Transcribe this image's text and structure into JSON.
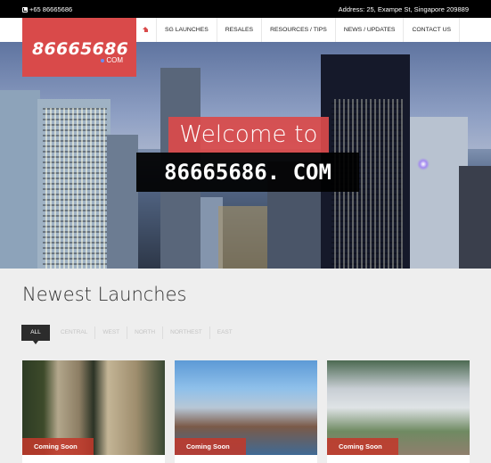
{
  "topbar": {
    "phone_icon": "phone-icon",
    "phone": "+65 86665686",
    "address": "Address: 25, Exampe St, Singapore 209889"
  },
  "logo": {
    "number": "86665686",
    "suffix": "COM",
    "dot_color": "#6a8cf0",
    "bg_color": "#d94a4a"
  },
  "nav": {
    "home_icon": "home-icon",
    "items": [
      {
        "label": "SG LAUNCHES"
      },
      {
        "label": "RESALES"
      },
      {
        "label": "RESOURCES / TIPS"
      },
      {
        "label": "NEWS / UPDATES"
      },
      {
        "label": "CONTACT US"
      }
    ]
  },
  "hero": {
    "line1": "Welcome to",
    "line2": "86665686. COM"
  },
  "launches": {
    "title": "Newest Launches",
    "filters": [
      {
        "label": "ALL",
        "active": true
      },
      {
        "label": "CENTRAL"
      },
      {
        "label": "WEST"
      },
      {
        "label": "NORTH"
      },
      {
        "label": "NORTHEST"
      },
      {
        "label": "EAST"
      }
    ],
    "cards": [
      {
        "badge": "Coming Soon"
      },
      {
        "badge": "Coming Soon"
      },
      {
        "badge": "Coming Soon"
      }
    ]
  }
}
